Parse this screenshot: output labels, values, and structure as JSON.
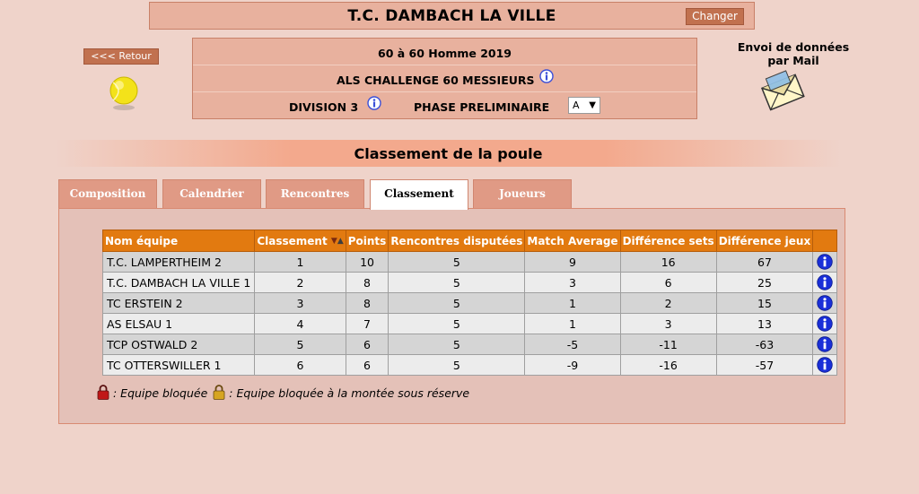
{
  "header": {
    "club_name": "T.C. DAMBACH LA VILLE",
    "change_label": "Changer",
    "back_label": "<<< Retour"
  },
  "competition": {
    "line1": "60  à 60  Homme  2019",
    "line2": "ALS CHALLENGE 60 MESSIEURS",
    "division": "DIVISION 3",
    "phase": "PHASE PRELIMINAIRE",
    "poule_selected": "A"
  },
  "mail": {
    "label_line1": "Envoi de données",
    "label_line2": "par Mail"
  },
  "section": {
    "title": "Classement de la poule"
  },
  "tabs": [
    {
      "label": "Composition",
      "active": false
    },
    {
      "label": "Calendrier",
      "active": false
    },
    {
      "label": "Rencontres",
      "active": false
    },
    {
      "label": "Classement",
      "active": true
    },
    {
      "label": "Joueurs",
      "active": false
    }
  ],
  "table": {
    "headers": [
      "Nom équipe",
      "Classement",
      "Points",
      "Rencontres disputées",
      "Match Average",
      "Différence sets",
      "Différence jeux"
    ],
    "rows": [
      [
        "T.C. LAMPERTHEIM 2",
        "1",
        "10",
        "5",
        "9",
        "16",
        "67"
      ],
      [
        "T.C. DAMBACH LA VILLE 1",
        "2",
        "8",
        "5",
        "3",
        "6",
        "25"
      ],
      [
        "TC ERSTEIN 2",
        "3",
        "8",
        "5",
        "1",
        "2",
        "15"
      ],
      [
        "AS ELSAU 1",
        "4",
        "7",
        "5",
        "1",
        "3",
        "13"
      ],
      [
        "TCP OSTWALD 2",
        "5",
        "6",
        "5",
        "-5",
        "-11",
        "-63"
      ],
      [
        "TC OTTERSWILLER 1",
        "6",
        "6",
        "5",
        "-9",
        "-16",
        "-57"
      ]
    ]
  },
  "legend": {
    "blocked": ": Equipe bloquée",
    "blocked_promotion": ": Equipe bloquée à la montée sous réserve"
  },
  "colors": {
    "background": "#efd3ca",
    "header_orange": "#e27a10",
    "button": "#c1714f",
    "info_blue": "#1a2fd8"
  },
  "icons": {
    "ball": "tennis-ball-icon",
    "mail": "envelope-icon",
    "info": "info-icon",
    "lock_red": "red-lock-icon",
    "lock_yellow": "yellow-lock-icon"
  }
}
